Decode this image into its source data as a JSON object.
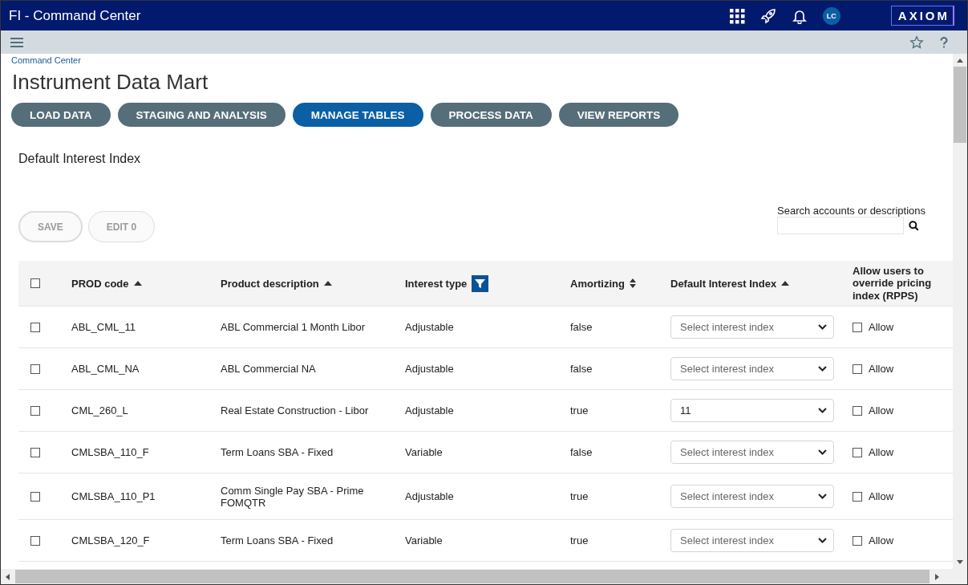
{
  "window": {
    "title": "FI - Command Center",
    "avatar": "LC",
    "logo": "AXIOM"
  },
  "breadcrumb": "Command Center",
  "page_title": "Instrument Data Mart",
  "nav_tabs": [
    {
      "label": "LOAD DATA",
      "selected": false
    },
    {
      "label": "STAGING AND ANALYSIS",
      "selected": false
    },
    {
      "label": "MANAGE TABLES",
      "selected": true
    },
    {
      "label": "PROCESS DATA",
      "selected": false
    },
    {
      "label": "VIEW REPORTS",
      "selected": false
    }
  ],
  "section_title": "Default Interest Index",
  "actions": [
    {
      "label": "SAVE",
      "disabled": true
    },
    {
      "label": "EDIT 0",
      "disabled": true
    }
  ],
  "search": {
    "label": "Search accounts or descriptions"
  },
  "table": {
    "select_all_checked": false,
    "columns": [
      {
        "label": "PROD code",
        "kind": "sort-asc"
      },
      {
        "label": "Product description",
        "kind": "sort-asc"
      },
      {
        "label": "Interest type",
        "kind": "filter"
      },
      {
        "label": "Amortizing",
        "kind": "sort-both"
      },
      {
        "label": "Default Interest Index",
        "kind": "sort-asc"
      },
      {
        "label": "Allow users to override pricing index (RPPS)",
        "kind": "plain"
      }
    ],
    "rows": [
      {
        "checked": false,
        "code": "ABL_CML_11",
        "description": "ABL Commercial 1 Month Libor",
        "interest_type": "Adjustable",
        "amortizing": "false",
        "index": {
          "placeholder": "Select interest index"
        },
        "allow": {
          "label": "Allow",
          "checked": false
        }
      },
      {
        "checked": false,
        "code": "ABL_CML_NA",
        "description": "ABL Commercial NA",
        "interest_type": "Adjustable",
        "amortizing": "false",
        "index": {
          "placeholder": "Select interest index"
        },
        "allow": {
          "label": "Allow",
          "checked": false
        }
      },
      {
        "checked": false,
        "code": "CML_260_L",
        "description": "Real Estate Construction - Libor",
        "interest_type": "Adjustable",
        "amortizing": "true",
        "index": {
          "value": "11"
        },
        "allow": {
          "label": "Allow",
          "checked": false
        }
      },
      {
        "checked": false,
        "code": "CMLSBA_110_F",
        "description": "Term Loans SBA - Fixed",
        "interest_type": "Variable",
        "amortizing": "false",
        "index": {
          "placeholder": "Select interest index"
        },
        "allow": {
          "label": "Allow",
          "checked": false
        }
      },
      {
        "checked": false,
        "code": "CMLSBA_110_P1",
        "description": "Comm Single Pay SBA - Prime FOMQTR",
        "interest_type": "Adjustable",
        "amortizing": "true",
        "index": {
          "placeholder": "Select interest index"
        },
        "allow": {
          "label": "Allow",
          "checked": false
        }
      },
      {
        "checked": false,
        "code": "CMLSBA_120_F",
        "description": "Term Loans SBA - Fixed",
        "interest_type": "Variable",
        "amortizing": "true",
        "index": {
          "placeholder": "Select interest index"
        },
        "allow": {
          "label": "Allow",
          "checked": false
        }
      }
    ]
  }
}
